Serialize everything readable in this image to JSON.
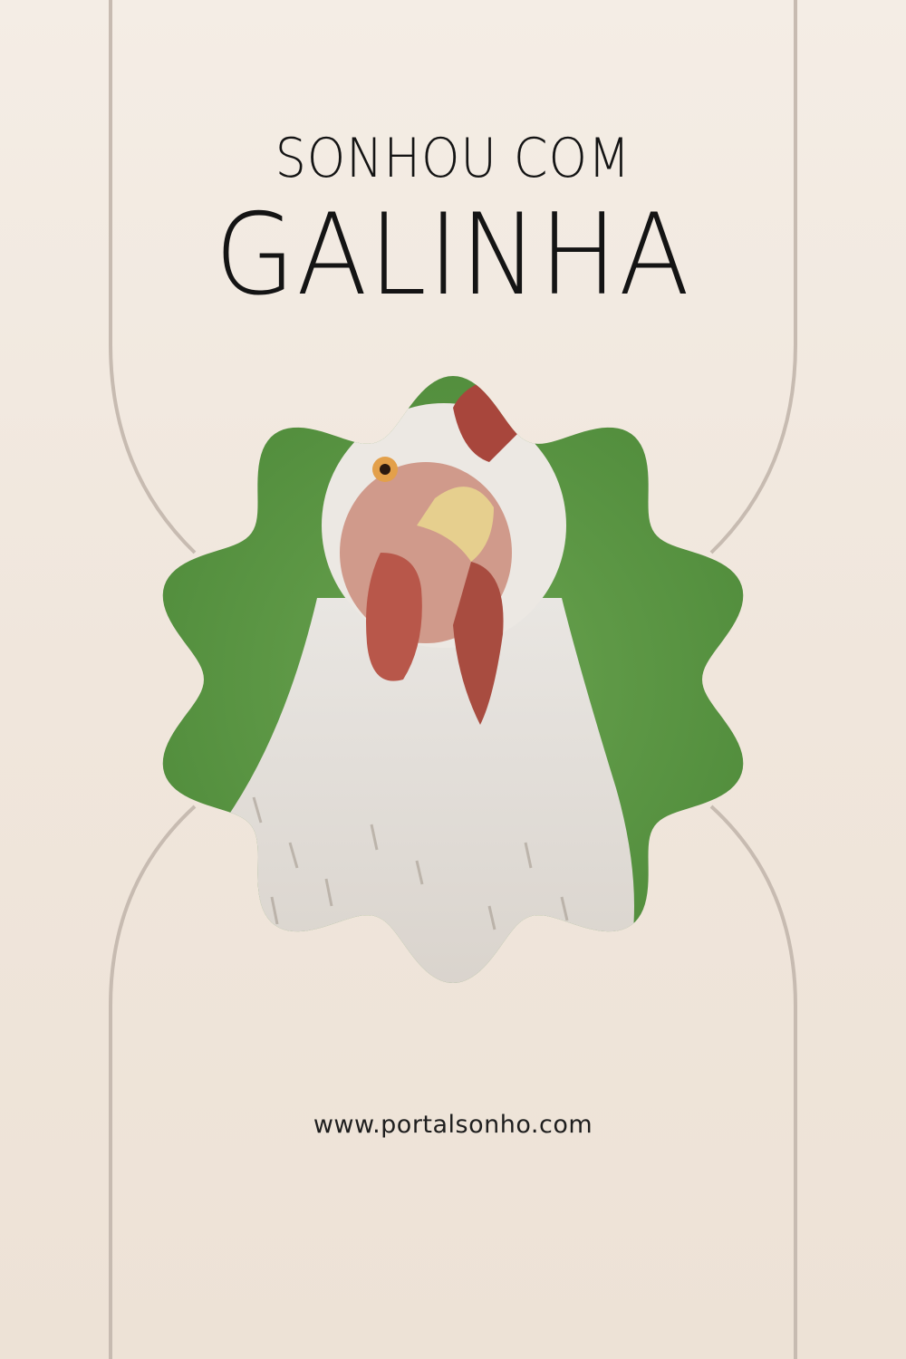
{
  "poster": {
    "subtitle": "SONHOU COM",
    "title": "GALINHA",
    "website": "www.portalsonho.com"
  },
  "image": {
    "subject": "chicken-portrait",
    "background_color": "#5e9a45",
    "frame_shape": "scalloped-circle"
  },
  "colors": {
    "background": "#f2e9e0",
    "line": "#c7bbb1",
    "text": "#141414"
  }
}
